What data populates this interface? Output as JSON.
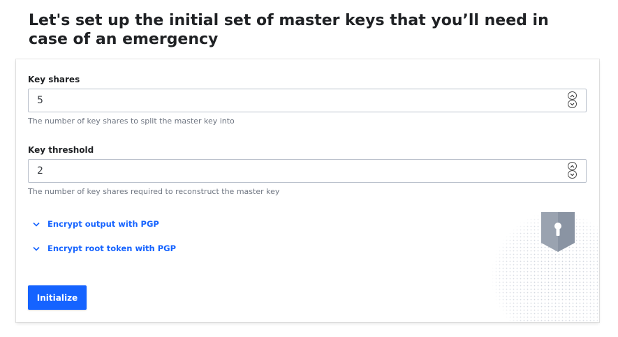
{
  "heading": {
    "title": "Let's set up the initial set of master keys that you’ll need in case of an emergency"
  },
  "form": {
    "key_shares": {
      "label": "Key shares",
      "value": "5",
      "help": "The number of key shares to split the master key into"
    },
    "key_threshold": {
      "label": "Key threshold",
      "value": "2",
      "help": "The number of key shares required to reconstruct the master key"
    },
    "toggles": [
      {
        "label": "Encrypt output with PGP",
        "icon": "chevron-down-icon"
      },
      {
        "label": "Encrypt root token with PGP",
        "icon": "chevron-down-icon"
      }
    ],
    "submit_label": "Initialize"
  },
  "colors": {
    "accent": "#1563ff",
    "text": "#1f2124",
    "muted": "#6f7682",
    "border": "#bac1cc",
    "watermark": "#8a94a3"
  },
  "icons": {
    "watermark": "vault-lock-shield-icon",
    "spinner_up": "chevron-up-icon",
    "spinner_down": "chevron-down-icon"
  }
}
